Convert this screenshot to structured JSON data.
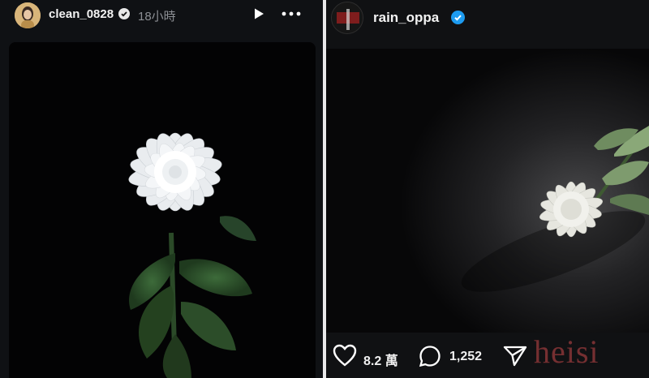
{
  "left_post": {
    "username": "clean_0828",
    "time": "18小時",
    "play_icon": "play-icon",
    "more_icon": "more-options-icon",
    "verified_icon": "verified-badge-icon"
  },
  "right_post": {
    "username": "rain_oppa",
    "verified_icon": "verified-badge-icon",
    "likes": "8.2 萬",
    "comments": "1,252",
    "like_icon": "heart-icon",
    "comment_icon": "comment-icon",
    "share_icon": "share-icon"
  },
  "watermark": "heisi",
  "colors": {
    "verified_blue": "#1d9bf0",
    "panel_bg": "#0f1114",
    "watermark_red": "#c8484a"
  }
}
